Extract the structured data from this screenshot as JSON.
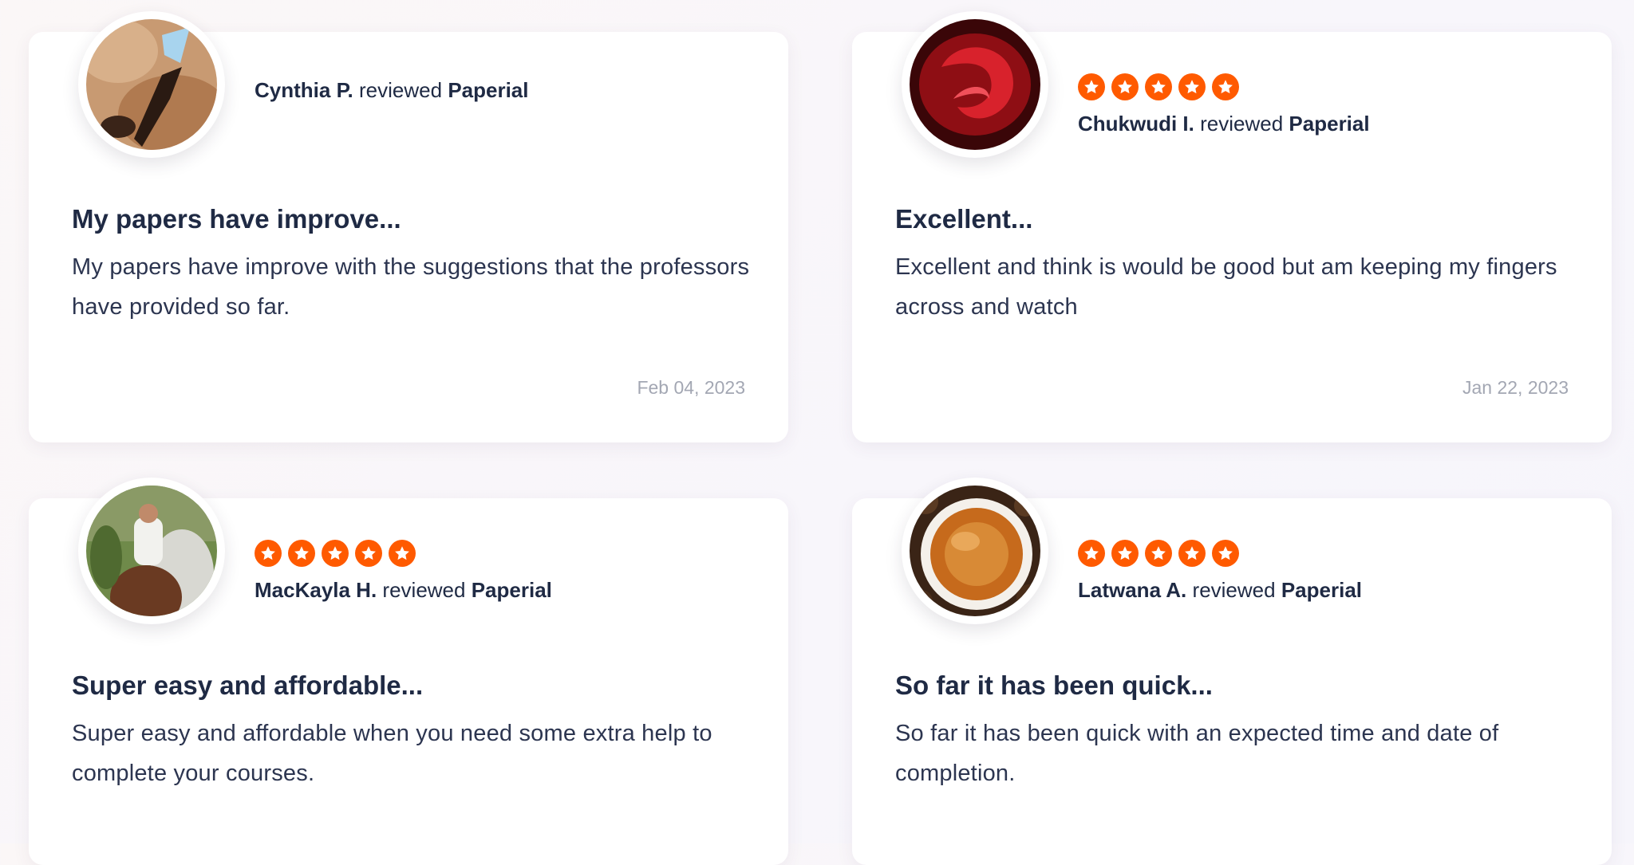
{
  "reviews": [
    {
      "reviewer": "Cynthia P.",
      "verb": "reviewed",
      "company": "Paperial",
      "rating": null,
      "title": "My papers have improve...",
      "body": "My papers have improve with the suggestions that the professors have provided so far.",
      "date": "Feb 04, 2023"
    },
    {
      "reviewer": "Chukwudi I.",
      "verb": "reviewed",
      "company": "Paperial",
      "rating": 5,
      "title": "Excellent...",
      "body": "Excellent and think is would be good but am keeping my fingers across and watch",
      "date": "Jan 22, 2023"
    },
    {
      "reviewer": "MacKayla H.",
      "verb": "reviewed",
      "company": "Paperial",
      "rating": 5,
      "title": "Super easy and affordable...",
      "body": "Super easy and affordable when you need some extra help to complete your courses.",
      "date": ""
    },
    {
      "reviewer": "Latwana A.",
      "verb": "reviewed",
      "company": "Paperial",
      "rating": 5,
      "title": "So far it has been quick...",
      "body": "So far it has been quick with an expected time and date of completion.",
      "date": ""
    }
  ],
  "colors": {
    "star": "#ff5a00",
    "text": "#1f2a44",
    "date": "#a3a7b3"
  }
}
